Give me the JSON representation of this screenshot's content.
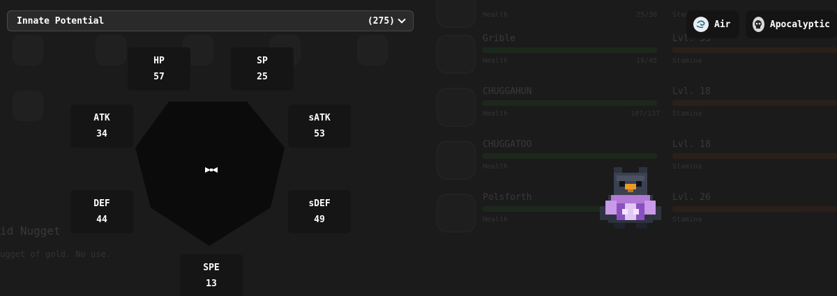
{
  "header": {
    "title": "Innate Potential",
    "count": "(275)"
  },
  "stats": {
    "hp": {
      "label": "HP",
      "value": "57"
    },
    "sp": {
      "label": "SP",
      "value": "25"
    },
    "atk": {
      "label": "ATK",
      "value": "34"
    },
    "satk": {
      "label": "sATK",
      "value": "53"
    },
    "def": {
      "label": "DEF",
      "value": "44"
    },
    "sdef": {
      "label": "sDEF",
      "value": "49"
    },
    "spe": {
      "label": "SPE",
      "value": "13"
    }
  },
  "types": [
    {
      "label": "Air",
      "icon": "air-swirl-icon"
    },
    {
      "label": "Apocalyptic",
      "icon": "skull-icon"
    }
  ],
  "background": {
    "item_name": "id Nugget",
    "item_desc": "ugget of gold. No use.",
    "party": [
      {
        "name": "",
        "level": "",
        "health": "Health",
        "health_val": "25/30",
        "stamina": "Stamina"
      },
      {
        "name": "Grible",
        "level": "Lvl. 33",
        "health": "Health",
        "health_val": "19/45",
        "stamina": "Stamina"
      },
      {
        "name": "CHUGGAHUN",
        "level": "Lvl. 18",
        "health": "Health",
        "health_val": "107/137",
        "stamina": "Stamina"
      },
      {
        "name": "CHUGGATOO",
        "level": "Lvl. 18",
        "health": "Health",
        "health_val": "",
        "stamina": "Stamina"
      },
      {
        "name": "Polsforth",
        "level": "Lvl. 26",
        "health": "Health",
        "health_val": "",
        "stamina": "Stamina"
      }
    ]
  },
  "colors": {
    "background": "#1b1b1b",
    "panel": "#151515",
    "header": "#2a2a2a",
    "radar": "#0a0a0a"
  }
}
